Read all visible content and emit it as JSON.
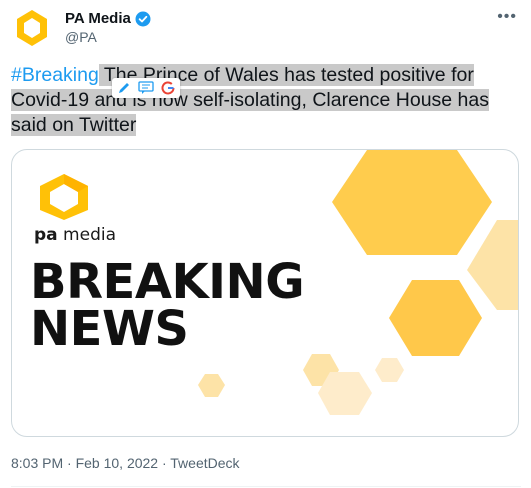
{
  "author": {
    "name": "PA Media",
    "handle": "@PA"
  },
  "tweet": {
    "hashtag": "#Breaking",
    "text_part1": " The Prince of Wales has tested positive for Covid-19 and is now self-isolating, Clarence House has said on Twitter"
  },
  "card": {
    "brand_bold": "pa",
    "brand_rest": " media",
    "headline_line1": "BREAKING",
    "headline_line2": "NEWS"
  },
  "meta": {
    "timestamp": "8:03 PM · Feb 10, 2022 · TweetDeck"
  },
  "colors": {
    "accent": "#1d9bf0",
    "hex_yellow": "#ffcc4d",
    "hex_light": "#fde3a7"
  },
  "icons": {
    "more": "more-icon",
    "verified": "verified-icon"
  }
}
